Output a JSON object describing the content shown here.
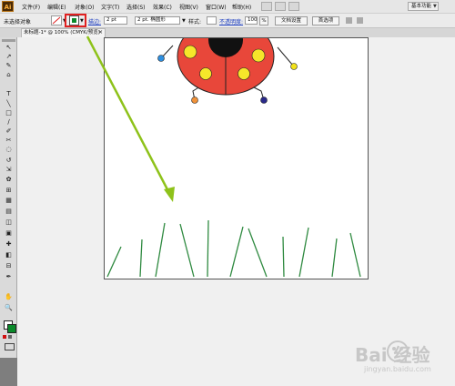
{
  "app": {
    "logo": "Ai"
  },
  "menubar": {
    "items": [
      "文件(F)",
      "编辑(E)",
      "对象(O)",
      "文字(T)",
      "选择(S)",
      "效果(C)",
      "视图(V)",
      "窗口(W)",
      "帮助(H)"
    ],
    "workspace": "基本功能"
  },
  "controlbar": {
    "selection_label": "未选择对象",
    "stroke_label": "描边:",
    "stroke_weight": "2 pt",
    "brush_preset": "2 pt. 椭圆形",
    "style_label": "样式:",
    "opacity_label": "不透明度:",
    "opacity_value": "100",
    "opacity_unit": "%",
    "doc_setup_button": "文档设置",
    "preferences_button": "首选项",
    "colors": {
      "stroke": "#0a8a2a",
      "highlight": "#e02020"
    }
  },
  "document": {
    "tab_title": "未标题-1* @ 100% (CMYK/预览)",
    "tab_close": "×"
  },
  "tools": [
    "↖",
    "↗",
    "✎",
    "⌂",
    "T",
    "╲",
    "□",
    "∕",
    "✐",
    "✂",
    "◌",
    "↺",
    "⇲",
    "✿",
    "⊞",
    "▦",
    "▤",
    "◫",
    "▣",
    "✚",
    "◧",
    "⊟",
    "✒",
    "✋",
    "🔍"
  ],
  "watermark": {
    "text": "Bai 经验",
    "sub": "jingyan.baidu.com"
  }
}
